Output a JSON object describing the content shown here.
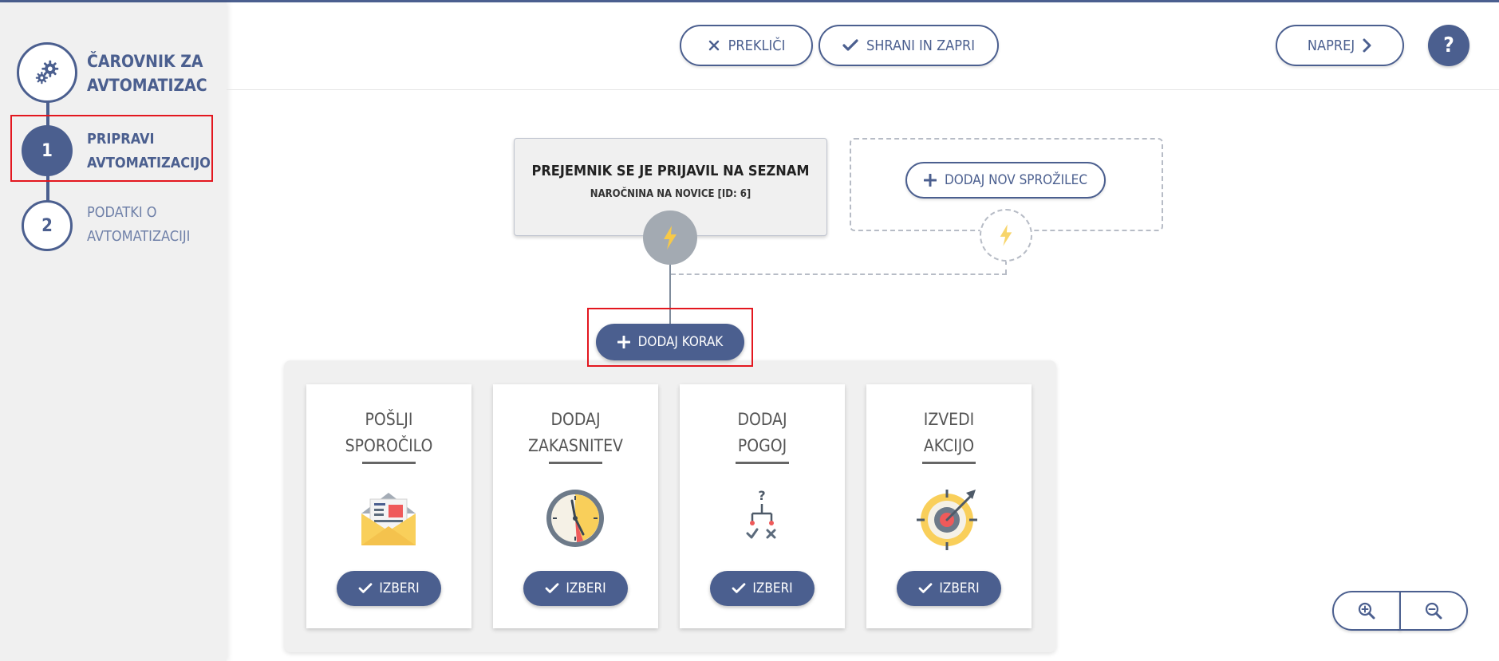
{
  "sidebar": {
    "wizard_title": "ČAROVNIK ZA AVTOMATIZACIJI",
    "wizard_icon": "gears-icon",
    "steps": [
      {
        "number": "1",
        "label_line1": "PRIPRAVI",
        "label_line2": "AVTOMATIZACIJO",
        "active": true
      },
      {
        "number": "2",
        "label_line1": "PODATKI O",
        "label_line2": "AVTOMATIZACIJI",
        "active": false
      }
    ]
  },
  "header": {
    "cancel_label": "PREKLIČI",
    "save_label": "SHRANI IN ZAPRI",
    "next_label": "NAPREJ",
    "help_label": "?"
  },
  "trigger": {
    "title": "PREJEMNIK SE JE PRIJAVIL NA SEZNAM",
    "subtitle": "NAROČNINA NA NOVICE [ID: 6]",
    "add_trigger_label": "DODAJ NOV SPROŽILEC"
  },
  "add_step_label": "DODAJ KORAK",
  "actions": [
    {
      "line1": "POŠLJI",
      "line2": "SPOROČILO",
      "icon": "envelope-icon",
      "select_label": "IZBERI"
    },
    {
      "line1": "DODAJ",
      "line2": "ZAKASNITEV",
      "icon": "clock-icon",
      "select_label": "IZBERI"
    },
    {
      "line1": "DODAJ",
      "line2": "POGOJ",
      "icon": "condition-icon",
      "select_label": "IZBERI"
    },
    {
      "line1": "IZVEDI",
      "line2": "AKCIJO",
      "icon": "target-icon",
      "select_label": "IZBERI"
    }
  ],
  "colors": {
    "accent": "#4b5f8f",
    "highlight": "#e3171f",
    "sidebar_bg": "#f0f0f0",
    "bolt": "#f7c948"
  }
}
